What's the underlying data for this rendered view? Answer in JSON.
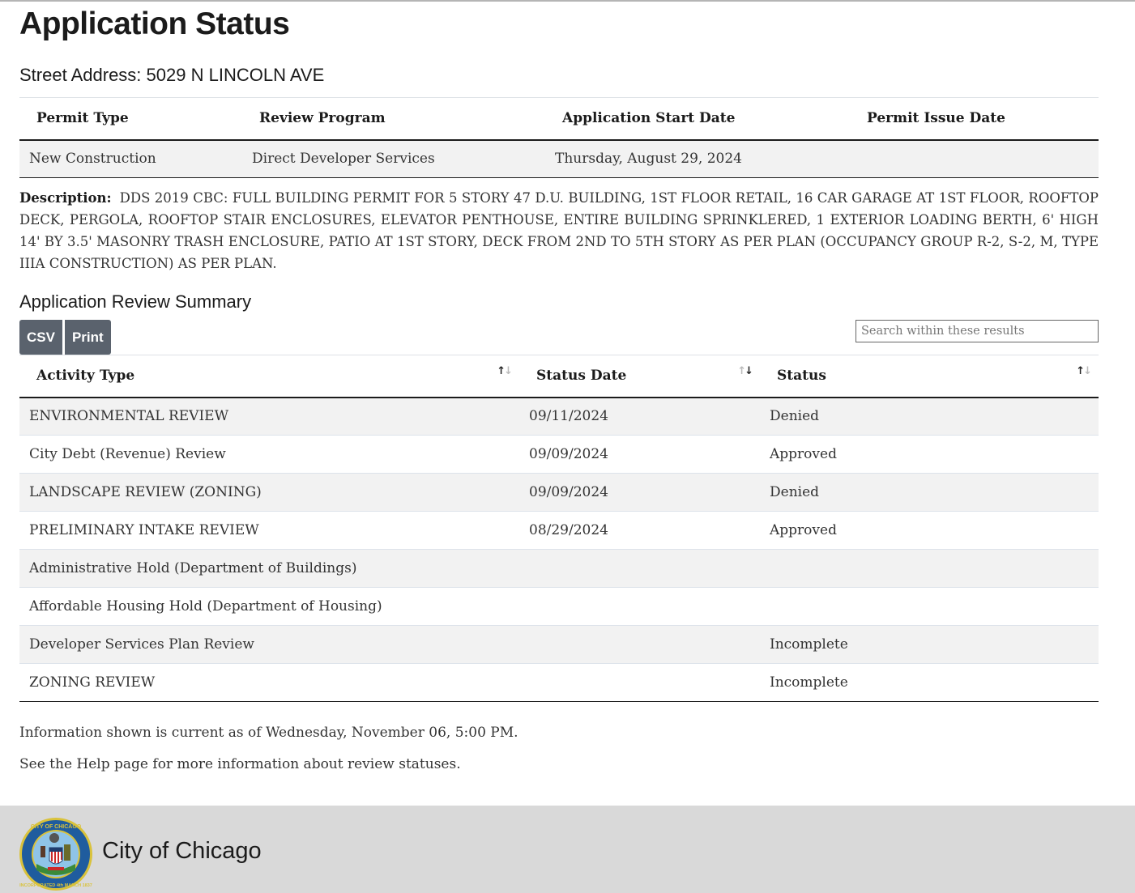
{
  "page": {
    "title": "Application Status",
    "address_label": "Street Address:",
    "address_value": "5029 N LINCOLN AVE"
  },
  "permit": {
    "headers": [
      "Permit Type",
      "Review Program",
      "Application Start Date",
      "Permit Issue Date"
    ],
    "row": [
      "New Construction",
      "Direct Developer Services",
      "Thursday, August 29, 2024",
      ""
    ]
  },
  "description": {
    "label": "Description:",
    "text": "DDS 2019 CBC: FULL BUILDING PERMIT FOR 5 STORY 47 D.U. BUILDING, 1ST FLOOR RETAIL, 16 CAR GARAGE AT 1ST FLOOR, ROOFTOP DECK, PERGOLA, ROOFTOP STAIR ENCLOSURES, ELEVATOR PENTHOUSE, ENTIRE BUILDING SPRINKLERED, 1 EXTERIOR LOADING BERTH, 6' HIGH 14' BY 3.5' MASONRY TRASH ENCLOSURE, PATIO AT 1ST STORY, DECK FROM 2ND TO 5TH STORY AS PER PLAN (OCCUPANCY GROUP R-2, S-2, M, TYPE IIIA CONSTRUCTION) AS PER PLAN."
  },
  "summary": {
    "title": "Application Review Summary",
    "buttons": {
      "csv": "CSV",
      "print": "Print"
    },
    "search_placeholder": "Search within these results",
    "search_value": "",
    "sort_icons": {
      "up": "↑",
      "down": "↓"
    },
    "sorted_column": "Status Date",
    "sort_direction": "descending",
    "headers": [
      "Activity Type",
      "Status Date",
      "Status"
    ],
    "rows": [
      [
        "ENVIRONMENTAL REVIEW",
        "09/11/2024",
        "Denied"
      ],
      [
        "City Debt (Revenue) Review",
        "09/09/2024",
        "Approved"
      ],
      [
        "LANDSCAPE REVIEW (ZONING)",
        "09/09/2024",
        "Denied"
      ],
      [
        "PRELIMINARY INTAKE REVIEW",
        "08/29/2024",
        "Approved"
      ],
      [
        "Administrative Hold (Department of Buildings)",
        "",
        ""
      ],
      [
        "Affordable Housing Hold (Department of Housing)",
        "",
        ""
      ],
      [
        "Developer Services Plan Review",
        "",
        "Incomplete"
      ],
      [
        "ZONING REVIEW",
        "",
        "Incomplete"
      ]
    ]
  },
  "info": {
    "current_as_of": "Information shown is current as of Wednesday, November 06, 5:00 PM.",
    "help_prefix": "See the ",
    "help_link": "Help page",
    "help_suffix": " for more information about review statuses."
  },
  "footer": {
    "title": "City of Chicago",
    "seal_icon": "city-of-chicago-seal-icon",
    "seal_text_top": "CITY OF CHICAGO",
    "seal_text_bottom": "INCORPORATED 4th MARCH 1837"
  },
  "colors": {
    "button_bg": "#5a626d",
    "row_stripe": "#f2f2f2",
    "footer_bg": "#d9d9d9",
    "seal_blue": "#1f5c9e",
    "seal_gold": "#d9c23b"
  }
}
